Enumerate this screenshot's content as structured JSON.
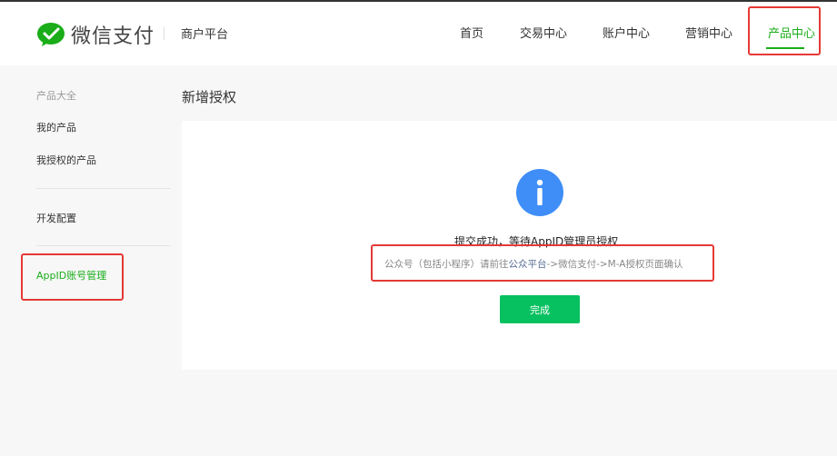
{
  "header": {
    "brand": "微信支付",
    "platform": "商户平台",
    "nav": [
      {
        "label": "首页"
      },
      {
        "label": "交易中心"
      },
      {
        "label": "账户中心"
      },
      {
        "label": "营销中心"
      },
      {
        "label": "产品中心",
        "active": true
      }
    ]
  },
  "sidebar": {
    "section_title": "产品大全",
    "items": [
      {
        "label": "我的产品"
      },
      {
        "label": "我授权的产品"
      },
      {
        "label": "开发配置"
      },
      {
        "label": "AppID账号管理",
        "active": true
      }
    ]
  },
  "main": {
    "title": "新增授权",
    "message_title": "提交成功，等待AppID管理员授权",
    "message_sub_prefix": "公众号（包括小程序）请前往",
    "message_sub_link": "公众平台",
    "message_sub_suffix": "->微信支付->M-A授权页面确认",
    "done_button": "完成"
  },
  "colors": {
    "accent": "#1aad19",
    "button": "#07c160",
    "info_icon": "#3f8ef7",
    "annotation": "#e53935"
  }
}
